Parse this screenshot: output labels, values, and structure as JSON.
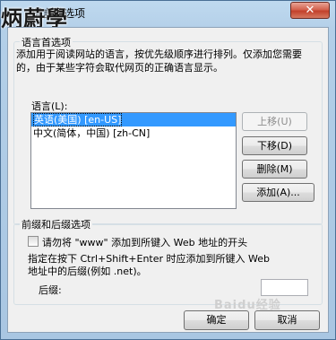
{
  "window": {
    "title": "语言首选项",
    "close_glyph": "✕",
    "watermark": "炳蔚學"
  },
  "lang_group": {
    "title": "语言首选项",
    "description": "添加用于阅读网站的语言，按优先级顺序进行排列。仅添加您需要的，由于某些字符会取代网页的正确语言显示。",
    "list_label": "语言(L):",
    "items": [
      {
        "label": "英语(美国) [en-US]",
        "selected": true
      },
      {
        "label": "中文(简体，中国) [zh-CN]",
        "selected": false
      }
    ],
    "buttons": {
      "move_up": "上移(U)",
      "move_down": "下移(D)",
      "remove": "删除(M)",
      "add": "添加(A)..."
    }
  },
  "suffix_group": {
    "title": "前缀和后缀选项",
    "checkbox_label": "请勿将 \"www\" 添加到所键入 Web 地址的开头",
    "checkbox_checked": false,
    "note_line1": "指定在按下 Ctrl+Shift+Enter 时应添加到所键入 Web",
    "note_line2": "地址中的后缀(例如 .net)。",
    "suffix_label": "后缀:",
    "suffix_value": ""
  },
  "footer": {
    "ok": "确定",
    "cancel": "取消",
    "baidu_watermark": "Baidu经验"
  }
}
